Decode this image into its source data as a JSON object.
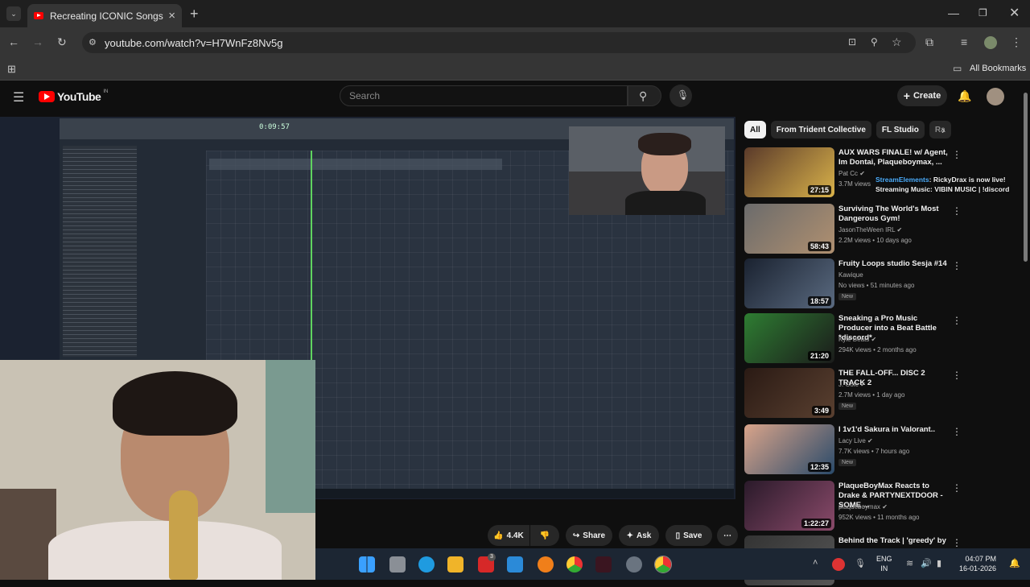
{
  "tab": {
    "title": "Recreating ICONIC Songs With",
    "close": "×",
    "new": "+"
  },
  "address": {
    "url": "youtube.com/watch?v=H7WnFz8Nv5g"
  },
  "bookmarks": {
    "label": "All Bookmarks"
  },
  "youtube": {
    "logo_text": "YouTube",
    "region": "IN",
    "search_placeholder": "Search",
    "create_label": "Create"
  },
  "video": {
    "overlay_time": "0:09:57"
  },
  "chips": [
    "All",
    "From Trident Collective",
    "FL Studio",
    "Ra"
  ],
  "chat_overlay": {
    "user": "StreamElements",
    "text": ": RickyDrax is now live!",
    "line2": "Streaming Music: VIBIN MUSIC | !discord"
  },
  "recommendations": [
    {
      "title": "AUX WARS FINALE! w/ Agent, Im Dontai, Plaqueboymax, ...",
      "channel": "Pat Cc",
      "views": "3.7M views",
      "age": "",
      "duration": "27:15",
      "new": "",
      "verified": true
    },
    {
      "title": "Surviving The World's Most Dangerous Gym!",
      "channel": "JasonTheWeen IRL",
      "views": "2.2M views",
      "age": "10 days ago",
      "duration": "58:43",
      "new": "",
      "verified": true
    },
    {
      "title": "Fruity Loops studio Sesja #14",
      "channel": "Kawique",
      "views": "No views",
      "age": "51 minutes ago",
      "duration": "18:57",
      "new": "New",
      "verified": false
    },
    {
      "title": "Sneaking a Pro Music Producer into a Beat Battle *discord*",
      "channel": "Kyle Beats",
      "views": "294K views",
      "age": "2 months ago",
      "duration": "21:20",
      "new": "",
      "verified": true
    },
    {
      "title": "THE FALL-OFF... DISC 2 TRACK 2",
      "channel": "J. Cole",
      "views": "2.7M views",
      "age": "1 day ago",
      "duration": "3:49",
      "new": "New",
      "verified": true
    },
    {
      "title": "I 1v1'd Sakura in Valorant..",
      "channel": "Lacy Live",
      "views": "7.7K views",
      "age": "7 hours ago",
      "duration": "12:35",
      "new": "New",
      "verified": true
    },
    {
      "title": "PlaqueBoyMax Reacts to Drake & PARTYNEXTDOOR - SOME ...",
      "channel": "plaqueboymax",
      "views": "952K views",
      "age": "11 months ago",
      "duration": "1:22:27",
      "new": "",
      "verified": true
    },
    {
      "title": "Behind the Track | 'greedy' by",
      "channel": "",
      "views": "",
      "age": "",
      "duration": "",
      "new": "",
      "verified": false
    }
  ],
  "actions": {
    "likes": "4.4K",
    "share": "Share",
    "ask": "Ask",
    "save": "Save"
  },
  "taskbar": {
    "lang1": "ENG",
    "lang2": "IN",
    "time": "04:07 PM",
    "date": "16-01-2026",
    "badge": "3"
  }
}
